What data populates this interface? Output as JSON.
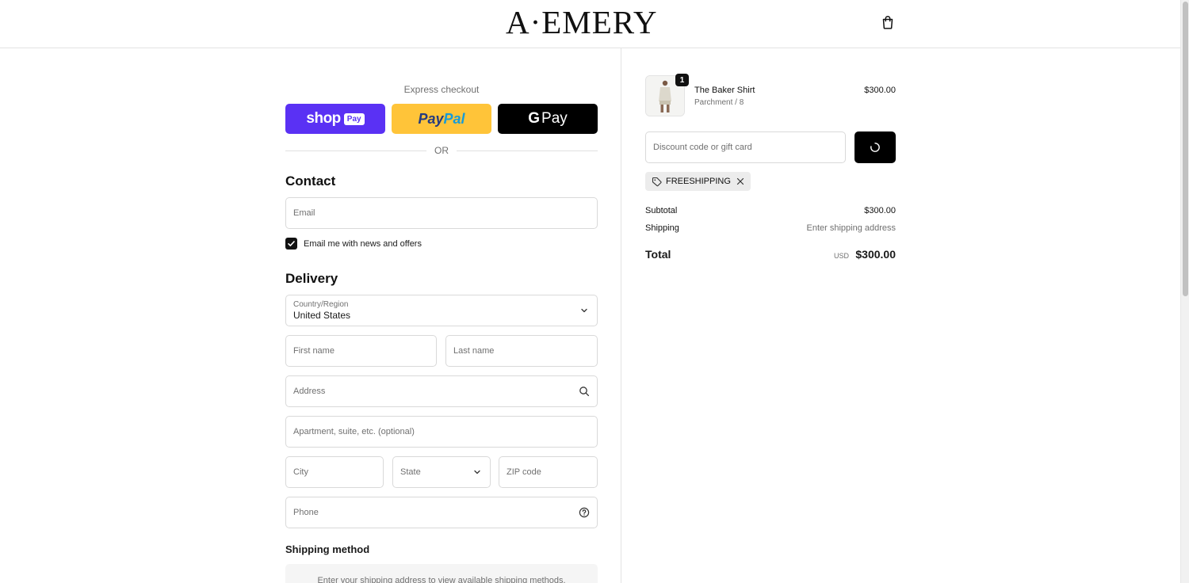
{
  "header": {
    "logo": "A·EMERY",
    "cart_icon": "shopping-bag-icon"
  },
  "express": {
    "label": "Express checkout",
    "shop_pay": {
      "shop": "shop",
      "pay": "Pay"
    },
    "paypal": {
      "part1": "Pay",
      "part2": "Pal"
    },
    "google_pay": {
      "g": "G",
      "pay": "Pay"
    },
    "or": "OR"
  },
  "contact": {
    "title": "Contact",
    "email_placeholder": "Email",
    "newsletter_label": "Email me with news and offers",
    "newsletter_checked": true
  },
  "delivery": {
    "title": "Delivery",
    "country_label": "Country/Region",
    "country_value": "United States",
    "first_name_placeholder": "First name",
    "last_name_placeholder": "Last name",
    "address_placeholder": "Address",
    "apartment_placeholder": "Apartment, suite, etc. (optional)",
    "city_placeholder": "City",
    "state_placeholder": "State",
    "zip_placeholder": "ZIP code",
    "phone_placeholder": "Phone"
  },
  "shipping": {
    "title": "Shipping method",
    "notice": "Enter your shipping address to view available shipping methods."
  },
  "order": {
    "item": {
      "name": "The Baker Shirt",
      "variant": "Parchment / 8",
      "price": "$300.00",
      "quantity": "1"
    },
    "discount_placeholder": "Discount code or gift card",
    "applied_code": "FREESHIPPING",
    "subtotal_label": "Subtotal",
    "subtotal_value": "$300.00",
    "shipping_label": "Shipping",
    "shipping_value": "Enter shipping address",
    "total_label": "Total",
    "currency": "USD",
    "total_value": "$300.00"
  },
  "colors": {
    "shop_pay": "#5a31f4",
    "paypal": "#ffc439",
    "accent": "#000000"
  }
}
